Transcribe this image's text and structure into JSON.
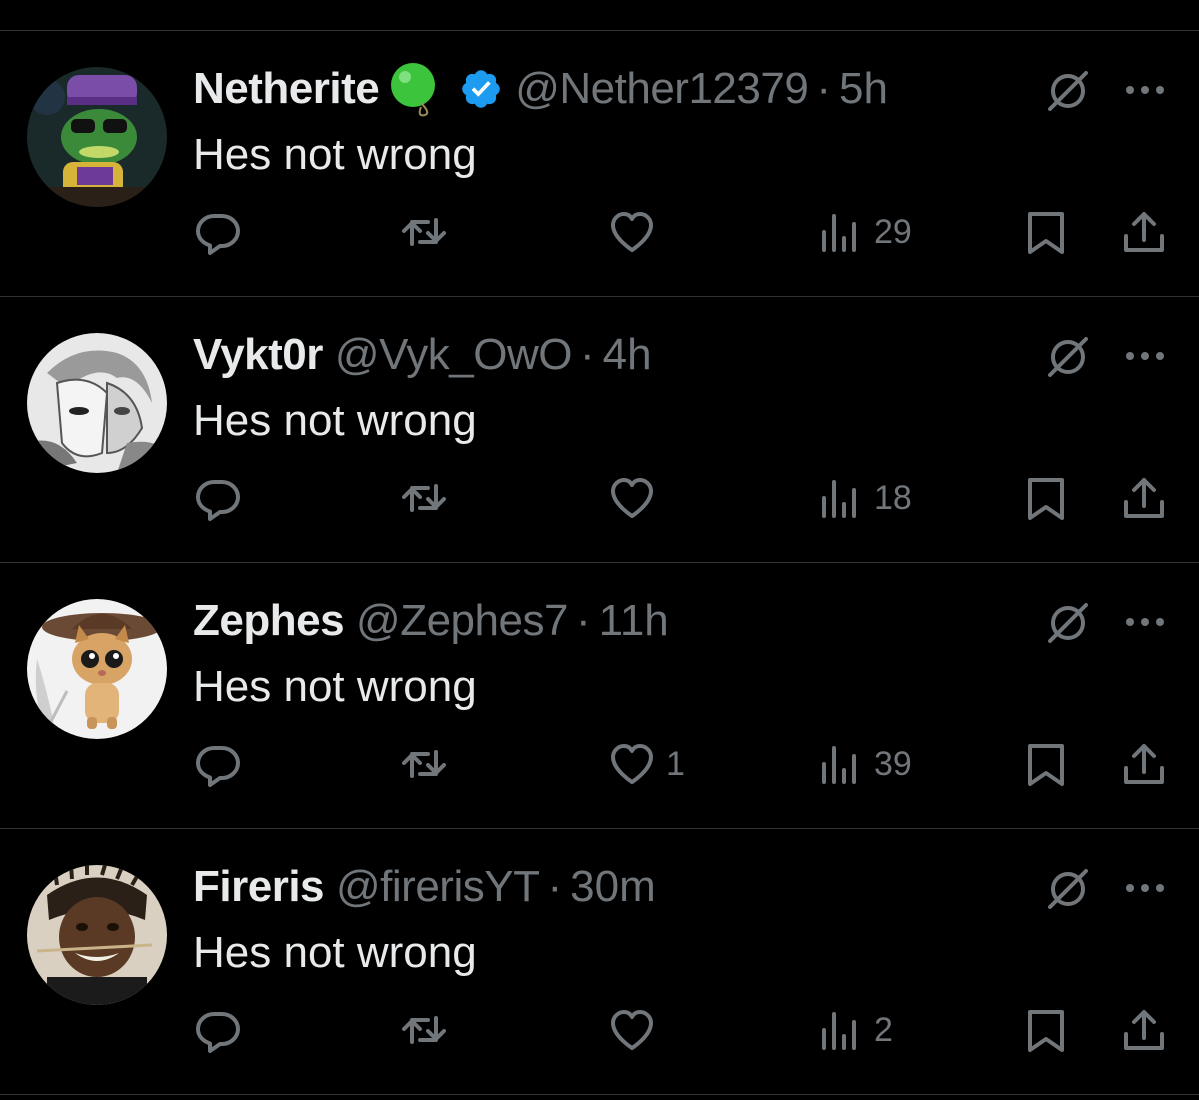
{
  "posts": [
    {
      "name": "Netherite",
      "has_badge_emoji": true,
      "verified": true,
      "handle": "@Nether12379",
      "separator": "·",
      "time": "5h",
      "text": "Hes not wrong",
      "likes": "",
      "views": "29",
      "avatar": "frog-avatar"
    },
    {
      "name": "Vykt0r",
      "has_badge_emoji": false,
      "verified": false,
      "handle": "@Vyk_OwO",
      "separator": "·",
      "time": "4h",
      "text": "Hes not wrong",
      "likes": "",
      "views": "18",
      "avatar": "anime-sketch-avatar"
    },
    {
      "name": "Zephes",
      "has_badge_emoji": false,
      "verified": false,
      "handle": "@Zephes7",
      "separator": "·",
      "time": "11h",
      "text": "Hes not wrong",
      "likes": "1",
      "views": "39",
      "avatar": "cat-avatar"
    },
    {
      "name": "Fireris",
      "has_badge_emoji": false,
      "verified": false,
      "handle": "@firerisYT",
      "separator": "·",
      "time": "30m",
      "text": "Hes not wrong",
      "likes": "",
      "views": "2",
      "avatar": "person-photo-avatar"
    }
  ],
  "colors": {
    "background": "#000000",
    "text_primary": "#e7e9ea",
    "text_secondary": "#71767b",
    "divider": "#2f3336",
    "verified_blue": "#1d9bf0",
    "badge_green": "#3cc43c"
  },
  "icons": [
    "reply-icon",
    "repost-icon",
    "like-icon",
    "views-icon",
    "bookmark-icon",
    "share-icon",
    "grok-icon",
    "more-icon",
    "verified-icon"
  ]
}
